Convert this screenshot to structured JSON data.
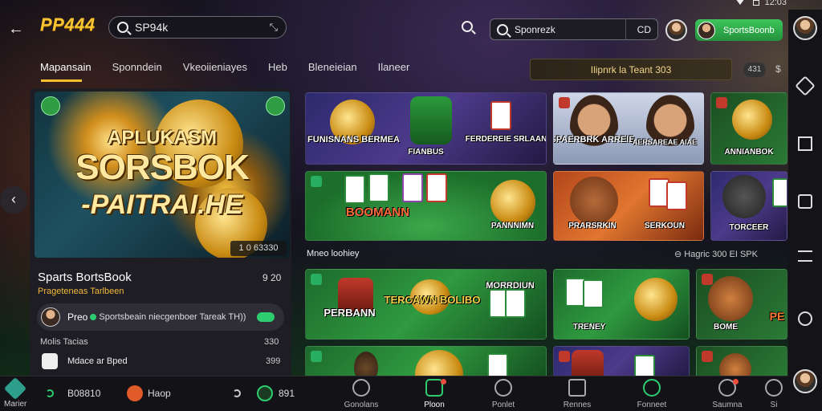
{
  "status": {
    "time": "12:03"
  },
  "header": {
    "logo": "PP444",
    "search_left": "SP94k",
    "search_right": "Sponrezk",
    "cc": "CD",
    "sports_button": "SportsBoonb"
  },
  "tabs": [
    {
      "label": "Mapansain",
      "active": true
    },
    {
      "label": "Sponndein",
      "active": false
    },
    {
      "label": "Vkeoiieniayes",
      "active": false
    },
    {
      "label": "Heb",
      "active": false
    },
    {
      "label": "Bleneieian",
      "active": false
    },
    {
      "label": "Ilaneer",
      "active": false
    }
  ],
  "promo": {
    "text": "Ilipnrk la Teant 303",
    "pill": "431",
    "chevron": "$"
  },
  "hero": {
    "line1": "APLUKASM",
    "line2": "SORSBOK",
    "line3": "-PAITRAI.HE",
    "code": "1 0 63330"
  },
  "left_panel": {
    "title": "Sparts BortsBook",
    "subtitle": "Prageteneas Tarlbeen",
    "number": "9 20",
    "row_name": "Preo",
    "row_text": "Sportsbeain niecgenboer Tareak TH))",
    "row2_label": "Molis Tacias",
    "row2_value": "330",
    "row3_label": "Mdace ar Bped",
    "row3_value": "399"
  },
  "tiles": {
    "t1": "FUNISNANS BERMEA",
    "t2": "FIANBUS",
    "t3": "FERDEREIE SRLAAN",
    "t4": "SPAERBRK ARREIE",
    "t5": "AERSAREAE AIAE",
    "t6": "ANNIANBOK",
    "t7": "BOOMANN",
    "t8": "PANNNIMN",
    "t9": "PRARSRKIN",
    "t10": "SERKOUN",
    "t11": "TORCEER",
    "t12": "PERBANN",
    "t13": "TERCAWN BOLIBO",
    "t14": "MORRDIUN",
    "t15": "TRENEY",
    "t16": "BOME",
    "t17": "PE"
  },
  "section": {
    "label": "Mneo loohiey",
    "right": "⊖ Hagric 300 EI SPK"
  },
  "bottom_left": {
    "label": "Marier",
    "item1": "B08810",
    "item2": "Haop",
    "item3": "891"
  },
  "nav": [
    {
      "label": "Gonolans",
      "active": false
    },
    {
      "label": "Ploon",
      "active": true
    },
    {
      "label": "Ponlet",
      "active": false
    },
    {
      "label": "Rennes",
      "active": false
    },
    {
      "label": "Fonneet",
      "active": false
    },
    {
      "label": "Saumna",
      "active": false
    },
    {
      "label": "Si",
      "active": false
    }
  ],
  "colors": {
    "accent": "#f4c02b",
    "green": "#2ecc71"
  }
}
